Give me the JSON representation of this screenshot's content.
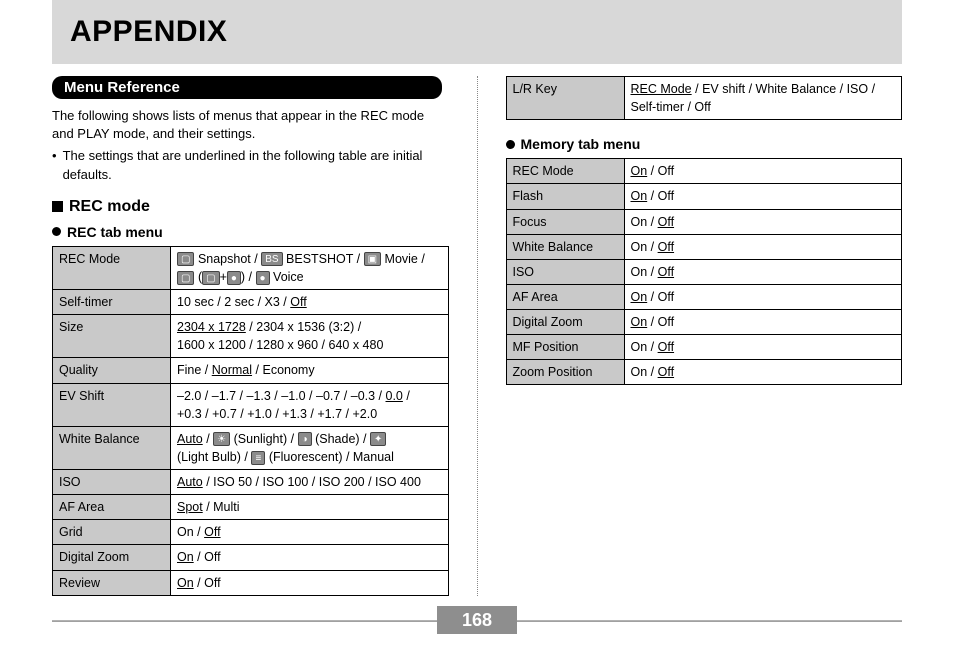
{
  "header": {
    "title": "APPENDIX"
  },
  "pill": {
    "title": "Menu Reference"
  },
  "intro": "The following shows lists of menus that appear in the REC mode and PLAY mode, and their settings.",
  "bullet": "The settings that are underlined in the following table are initial defaults.",
  "rec_heading": "REC mode",
  "rec_tab_heading": "REC tab menu",
  "mem_tab_heading": "Memory tab menu",
  "page_number": "168",
  "recTab": {
    "r0k": "REC Mode",
    "r0v_a": "Snapshot /",
    "r0v_b": "BESTSHOT /",
    "r0v_c": "Movie /",
    "r0v_d": "(",
    "r0v_e": "+",
    "r0v_f": ") /",
    "r0v_g": "Voice",
    "r1k": "Self-timer",
    "r1v_a": "10 sec / 2 sec / X3 /",
    "r1v_b": "Off",
    "r2k": "Size",
    "r2v_a": "2304 x 1728",
    "r2v_b": "/ 2304 x 1536 (3:2) /",
    "r2v_c": "1600 x 1200 / 1280 x 960 / 640 x 480",
    "r3k": "Quality",
    "r3v_a": "Fine /",
    "r3v_b": "Normal",
    "r3v_c": "/ Economy",
    "r4k": "EV Shift",
    "r4v_a": "–2.0 / –1.7 / –1.3 / –1.0 / –0.7 / –0.3 /",
    "r4v_b": "0.0",
    "r4v_c": "/",
    "r4v_d": "+0.3 / +0.7 / +1.0 / +1.3 / +1.7 / +2.0",
    "r5k": "White Balance",
    "r5v_a": "Auto",
    "r5v_b": "/",
    "r5v_c": "(Sunlight) /",
    "r5v_d": "(Shade) /",
    "r5v_e": "(Light Bulb) /",
    "r5v_f": "(Fluorescent) / Manual",
    "r6k": "ISO",
    "r6v_a": "Auto",
    "r6v_b": "/ ISO 50 / ISO 100 / ISO 200 / ISO 400",
    "r7k": "AF Area",
    "r7v_a": "Spot",
    "r7v_b": "/ Multi",
    "r8k": "Grid",
    "r8v_a": "On /",
    "r8v_b": "Off",
    "r9k": "Digital Zoom",
    "r9v_a": "On",
    "r9v_b": "/ Off",
    "r10k": "Review",
    "r10v_a": "On",
    "r10v_b": "/ Off"
  },
  "lrRow": {
    "k": "L/R Key",
    "v_a": "REC Mode",
    "v_b": "/ EV shift / White Balance / ISO /",
    "v_c": "Self-timer / Off"
  },
  "memTab": {
    "m0k": "REC Mode",
    "m0a": "On",
    "m0b": "/ Off",
    "m1k": "Flash",
    "m1a": "On",
    "m1b": "/ Off",
    "m2k": "Focus",
    "m2a": "On /",
    "m2b": "Off",
    "m3k": "White Balance",
    "m3a": "On /",
    "m3b": "Off",
    "m4k": "ISO",
    "m4a": "On /",
    "m4b": "Off",
    "m5k": "AF Area",
    "m5a": "On",
    "m5b": "/ Off",
    "m6k": "Digital Zoom",
    "m6a": "On",
    "m6b": "/ Off",
    "m7k": "MF Position",
    "m7a": "On /",
    "m7b": "Off",
    "m8k": "Zoom Position",
    "m8a": "On /",
    "m8b": "Off"
  },
  "icons": {
    "snapshot": "▢",
    "bestshot": "BS",
    "movie": "▣",
    "coupling_a": "▢",
    "mic": "●",
    "voice": "●",
    "sunlight": "☀",
    "shade": "◑",
    "lightbulb": "✦",
    "fluorescent": "≡"
  }
}
